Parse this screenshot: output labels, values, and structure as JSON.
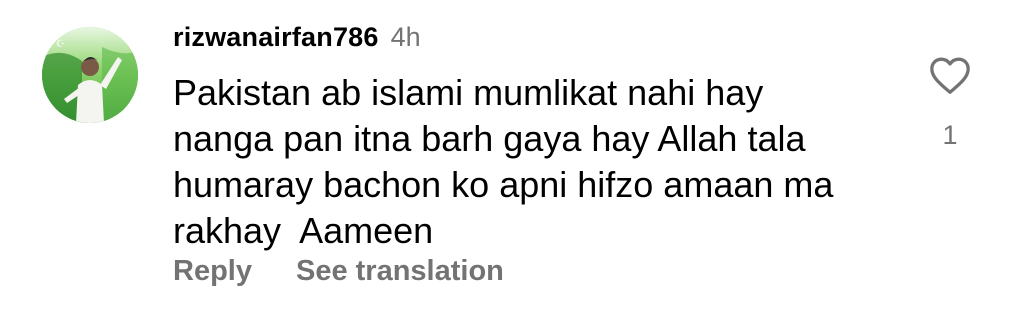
{
  "comment": {
    "username": "rizwanairfan786",
    "timestamp": "4h",
    "text": "Pakistan ab islami mumlikat nahi hay\nnanga pan itna barh gaya hay Allah tala\nhumaray bachon ko apni hifzo amaan ma\nrakhay  Aameen",
    "reply_label": "Reply",
    "translate_label": "See translation",
    "like_count": "1"
  },
  "icons": {
    "like": "heart-outline-icon"
  },
  "colors": {
    "secondary_text": "#737373",
    "primary_text": "#000000"
  }
}
